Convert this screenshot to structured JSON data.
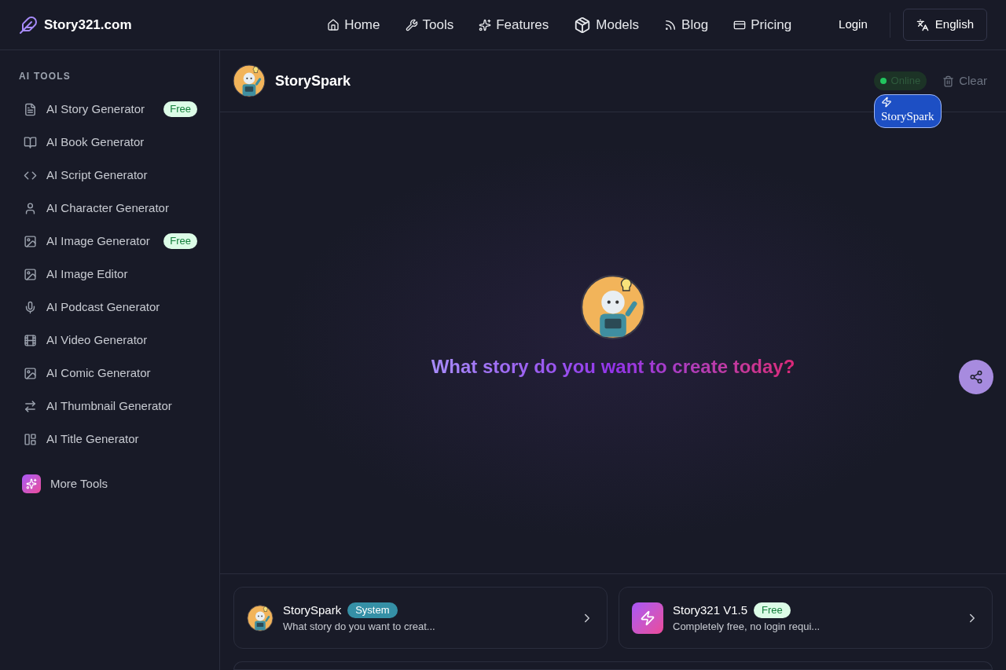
{
  "brand": {
    "name": "Story321.com"
  },
  "nav": [
    {
      "label": "Home",
      "kind": "home"
    },
    {
      "label": "Tools",
      "kind": "wrench"
    },
    {
      "label": "Features",
      "kind": "sparkles"
    },
    {
      "label": "Models",
      "kind": "box"
    },
    {
      "label": "Blog",
      "kind": "rss"
    },
    {
      "label": "Pricing",
      "kind": "card"
    }
  ],
  "login": "Login",
  "language": "English",
  "sidebar": {
    "heading": "AI TOOLS",
    "items": [
      {
        "label": "AI Story Generator",
        "kind": "file",
        "badge": "Free"
      },
      {
        "label": "AI Book Generator",
        "kind": "book"
      },
      {
        "label": "AI Script Generator",
        "kind": "code"
      },
      {
        "label": "AI Character Generator",
        "kind": "user"
      },
      {
        "label": "AI Image Generator",
        "kind": "image",
        "badge": "Free"
      },
      {
        "label": "AI Image Editor",
        "kind": "image"
      },
      {
        "label": "AI Podcast Generator",
        "kind": "mic"
      },
      {
        "label": "AI Video Generator",
        "kind": "film"
      },
      {
        "label": "AI Comic Generator",
        "kind": "image"
      },
      {
        "label": "AI Thumbnail Generator",
        "kind": "swap"
      },
      {
        "label": "AI Title Generator",
        "kind": "layout"
      }
    ],
    "more": "More Tools"
  },
  "chat": {
    "title": "StorySpark",
    "status": "Online",
    "clear": "Clear",
    "overlay": "StorySpark",
    "prompt": "What story do you want to create today?"
  },
  "models": [
    {
      "name": "StorySpark",
      "tag": "System",
      "kind": "avatar",
      "description": "What story do you want to creat..."
    },
    {
      "name": "Story321 V1.5",
      "tag": "Free",
      "kind": "bolt",
      "description": "Completely free, no login requi..."
    }
  ]
}
